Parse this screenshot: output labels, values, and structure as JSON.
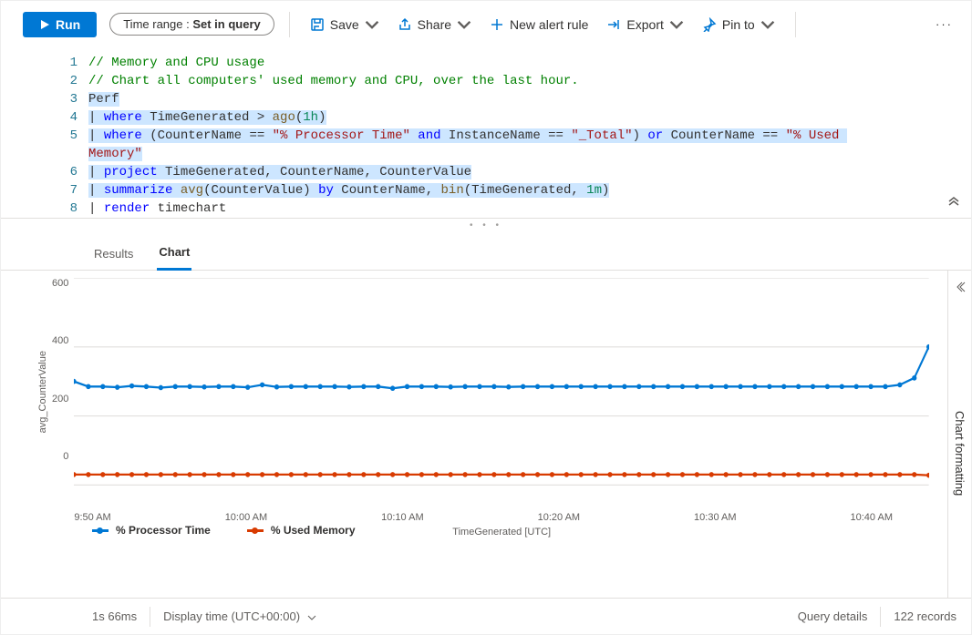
{
  "toolbar": {
    "run": "Run",
    "time_range_label": "Time range : ",
    "time_range_value": "Set in query",
    "save": "Save",
    "share": "Share",
    "new_alert": "New alert rule",
    "export": "Export",
    "pin_to": "Pin to",
    "more": "···"
  },
  "editor": {
    "lines": [
      {
        "n": "1",
        "raw": "// Memory and CPU usage",
        "cls": "cmt"
      },
      {
        "n": "2",
        "raw": "// Chart all computers' used memory and CPU, over the last hour.",
        "cls": "cmt"
      },
      {
        "n": "3",
        "html": "<span class='hl'>Perf</span>"
      },
      {
        "n": "4",
        "html": "<span class='hl'>| <span class='kw'>where</span> TimeGenerated &gt; <span class='fn'>ago</span>(<span class='num'>1h</span>)</span>"
      },
      {
        "n": "5",
        "html": "<span class='hl'>| <span class='kw'>where</span> (CounterName == <span class='str'>\"% Processor Time\"</span> <span class='kw'>and</span> InstanceName == <span class='str'>\"_Total\"</span>) <span class='kw'>or</span> CounterName == <span class='str'>\"% Used </span></span>"
      },
      {
        "n": "",
        "html": "<span class='hl'><span class='str'>Memory\"</span></span>"
      },
      {
        "n": "6",
        "html": "<span class='hl'>| <span class='kw'>project</span> TimeGenerated, CounterName, CounterValue</span>"
      },
      {
        "n": "7",
        "html": "<span class='hl'>| <span class='kw'>summarize</span> <span class='fn'>avg</span>(CounterValue) <span class='kw'>by</span> CounterName, <span class='fn'>bin</span>(TimeGenerated, <span class='num'>1m</span>)</span>"
      },
      {
        "n": "8",
        "html": "| <span class='kw'>render</span> timechart"
      }
    ]
  },
  "tabs": {
    "results": "Results",
    "chart": "Chart"
  },
  "chart_data": {
    "type": "line",
    "title": "",
    "ylabel": "avg_CounterValue",
    "xlabel": "TimeGenerated [UTC]",
    "ylim": [
      0,
      600
    ],
    "y_ticks": [
      "600",
      "400",
      "200",
      "0"
    ],
    "x_ticks": [
      "9:50 AM",
      "10:00 AM",
      "10:10 AM",
      "10:20 AM",
      "10:30 AM",
      "10:40 AM"
    ],
    "series": [
      {
        "name": "% Processor Time",
        "color": "#0078d4",
        "values": [
          300,
          285,
          285,
          283,
          287,
          285,
          282,
          285,
          285,
          284,
          285,
          285,
          283,
          290,
          284,
          285,
          285,
          285,
          285,
          284,
          285,
          285,
          280,
          285,
          285,
          285,
          284,
          285,
          285,
          285,
          284,
          285,
          285,
          285,
          285,
          285,
          285,
          285,
          285,
          285,
          285,
          285,
          285,
          285,
          285,
          285,
          285,
          285,
          285,
          285,
          285,
          285,
          285,
          285,
          285,
          285,
          285,
          290,
          310,
          400
        ]
      },
      {
        "name": "% Used Memory",
        "color": "#d83b01",
        "values": [
          30,
          30,
          30,
          30,
          30,
          30,
          30,
          30,
          30,
          30,
          30,
          30,
          30,
          30,
          30,
          30,
          30,
          30,
          30,
          30,
          30,
          30,
          30,
          30,
          30,
          30,
          30,
          30,
          30,
          30,
          30,
          30,
          30,
          30,
          30,
          30,
          30,
          30,
          30,
          30,
          30,
          30,
          30,
          30,
          30,
          30,
          30,
          30,
          30,
          30,
          30,
          30,
          30,
          30,
          30,
          30,
          30,
          30,
          30,
          28
        ]
      }
    ]
  },
  "side_panel": {
    "label": "Chart formatting"
  },
  "status": {
    "elapsed": "1s 66ms",
    "display_time": "Display time (UTC+00:00)",
    "query_details": "Query details",
    "records": "122 records"
  }
}
